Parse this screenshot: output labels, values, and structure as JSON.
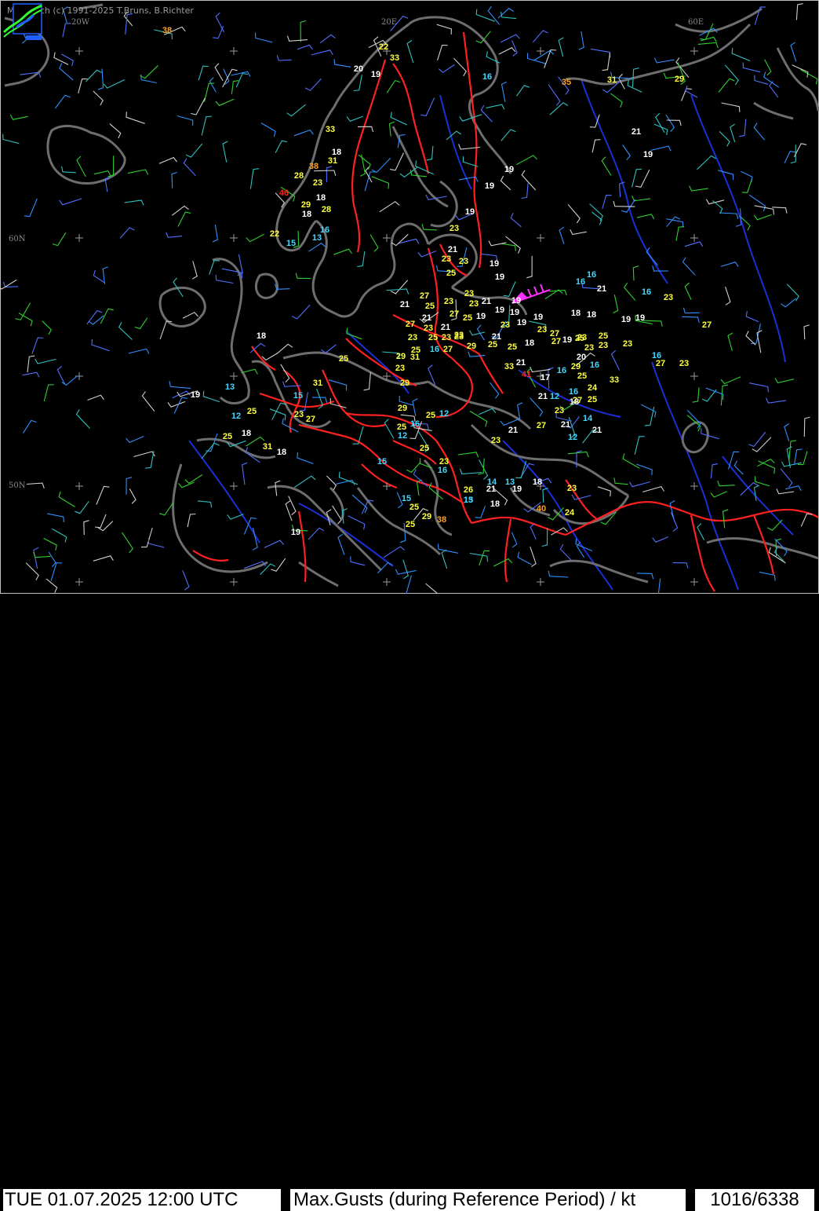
{
  "credit": "MetWatch  (c) 1991-2025 T.Bruns, B.Richter",
  "grid_labels": {
    "w20": "20W",
    "e20": "20E",
    "e60": "60E",
    "n60": "60N",
    "n50": "50N"
  },
  "status": {
    "datetime": "TUE 01.07.2025 12:00 UTC",
    "parameter": "Max.Gusts (during Reference Period) / kt",
    "counter": "1016/6338"
  },
  "colors": {
    "background": "#000000",
    "coast": "#6e6e6e",
    "border": "#ff2020",
    "river": "#1a2fd6",
    "gust_white": "#ffffff",
    "gust_cyan": "#40d8ff",
    "gust_yellow": "#ffff40",
    "gust_orange": "#ffa020",
    "gust_red": "#ff2020"
  },
  "gusts": [
    {
      "v": "38",
      "c": "o"
    },
    {
      "v": "22",
      "c": "y"
    },
    {
      "v": "33",
      "c": "y"
    },
    {
      "v": "20",
      "c": "w"
    },
    {
      "v": "19",
      "c": "w"
    },
    {
      "v": "16",
      "c": "c"
    },
    {
      "v": "35",
      "c": "o"
    },
    {
      "v": "31",
      "c": "y"
    },
    {
      "v": "29",
      "c": "y"
    },
    {
      "v": "33",
      "c": "y"
    },
    {
      "v": "21",
      "c": "w"
    },
    {
      "v": "18",
      "c": "w"
    },
    {
      "v": "31",
      "c": "y"
    },
    {
      "v": "19",
      "c": "w"
    },
    {
      "v": "38",
      "c": "o"
    },
    {
      "v": "28",
      "c": "y"
    },
    {
      "v": "23",
      "c": "y"
    },
    {
      "v": "19",
      "c": "w"
    },
    {
      "v": "46",
      "c": "r"
    },
    {
      "v": "18",
      "c": "w"
    },
    {
      "v": "19",
      "c": "w"
    },
    {
      "v": "29",
      "c": "y"
    },
    {
      "v": "28",
      "c": "y"
    },
    {
      "v": "18",
      "c": "w"
    },
    {
      "v": "19",
      "c": "w"
    },
    {
      "v": "23",
      "c": "y"
    },
    {
      "v": "16",
      "c": "c"
    },
    {
      "v": "22",
      "c": "y"
    },
    {
      "v": "13",
      "c": "c"
    },
    {
      "v": "15",
      "c": "c"
    },
    {
      "v": "21",
      "c": "w"
    },
    {
      "v": "23",
      "c": "y"
    },
    {
      "v": "23",
      "c": "y"
    },
    {
      "v": "19",
      "c": "w"
    },
    {
      "v": "25",
      "c": "y"
    },
    {
      "v": "19",
      "c": "w"
    },
    {
      "v": "16",
      "c": "c"
    },
    {
      "v": "16",
      "c": "c"
    },
    {
      "v": "21",
      "c": "w"
    },
    {
      "v": "23",
      "c": "y"
    },
    {
      "v": "16",
      "c": "c"
    },
    {
      "v": "27",
      "c": "y"
    },
    {
      "v": "21",
      "c": "w"
    },
    {
      "v": "25",
      "c": "y"
    },
    {
      "v": "23",
      "c": "y"
    },
    {
      "v": "23",
      "c": "y"
    },
    {
      "v": "21",
      "c": "w"
    },
    {
      "v": "19",
      "c": "m"
    },
    {
      "v": "19",
      "c": "w"
    },
    {
      "v": "23",
      "c": "y"
    },
    {
      "v": "21",
      "c": "w"
    },
    {
      "v": "27",
      "c": "y"
    },
    {
      "v": "25",
      "c": "y"
    },
    {
      "v": "19",
      "c": "w"
    },
    {
      "v": "19",
      "c": "w"
    },
    {
      "v": "18",
      "c": "w"
    },
    {
      "v": "18",
      "c": "w"
    },
    {
      "v": "19",
      "c": "w"
    },
    {
      "v": "19",
      "c": "w"
    },
    {
      "v": "19",
      "c": "w"
    },
    {
      "v": "27",
      "c": "y"
    },
    {
      "v": "27",
      "c": "y"
    },
    {
      "v": "23",
      "c": "y"
    },
    {
      "v": "21",
      "c": "w"
    },
    {
      "v": "23",
      "c": "y"
    },
    {
      "v": "19",
      "c": "w"
    },
    {
      "v": "23",
      "c": "y"
    },
    {
      "v": "27",
      "c": "y"
    },
    {
      "v": "23",
      "c": "y"
    },
    {
      "v": "18",
      "c": "w"
    },
    {
      "v": "23",
      "c": "y"
    },
    {
      "v": "25",
      "c": "y"
    },
    {
      "v": "23",
      "c": "y"
    },
    {
      "v": "23",
      "c": "y"
    },
    {
      "v": "21",
      "c": "w"
    },
    {
      "v": "23",
      "c": "y"
    },
    {
      "v": "19",
      "c": "w"
    },
    {
      "v": "25",
      "c": "y"
    },
    {
      "v": "25",
      "c": "y"
    },
    {
      "v": "27",
      "c": "y"
    },
    {
      "v": "29",
      "c": "y"
    },
    {
      "v": "25",
      "c": "y"
    },
    {
      "v": "23",
      "c": "y"
    },
    {
      "v": "23",
      "c": "y"
    },
    {
      "v": "23",
      "c": "y"
    },
    {
      "v": "18",
      "c": "w"
    },
    {
      "v": "25",
      "c": "y"
    },
    {
      "v": "16",
      "c": "c"
    },
    {
      "v": "27",
      "c": "y"
    },
    {
      "v": "25",
      "c": "y"
    },
    {
      "v": "29",
      "c": "y"
    },
    {
      "v": "31",
      "c": "y"
    },
    {
      "v": "25",
      "c": "y"
    },
    {
      "v": "21",
      "c": "w"
    },
    {
      "v": "33",
      "c": "y"
    },
    {
      "v": "16",
      "c": "c"
    },
    {
      "v": "20",
      "c": "w"
    },
    {
      "v": "16",
      "c": "c"
    },
    {
      "v": "27",
      "c": "y"
    },
    {
      "v": "23",
      "c": "y"
    },
    {
      "v": "23",
      "c": "y"
    },
    {
      "v": "31",
      "c": "y"
    },
    {
      "v": "29",
      "c": "y"
    },
    {
      "v": "41",
      "c": "r"
    },
    {
      "v": "17",
      "c": "w"
    },
    {
      "v": "16",
      "c": "c"
    },
    {
      "v": "29",
      "c": "y"
    },
    {
      "v": "25",
      "c": "y"
    },
    {
      "v": "33",
      "c": "y"
    },
    {
      "v": "19",
      "c": "w"
    },
    {
      "v": "13",
      "c": "c"
    },
    {
      "v": "15",
      "c": "c"
    },
    {
      "v": "24",
      "c": "y"
    },
    {
      "v": "16",
      "c": "c"
    },
    {
      "v": "12",
      "c": "c"
    },
    {
      "v": "25",
      "c": "y"
    },
    {
      "v": "23",
      "c": "y"
    },
    {
      "v": "27",
      "c": "y"
    },
    {
      "v": "29",
      "c": "y"
    },
    {
      "v": "25",
      "c": "y"
    },
    {
      "v": "27",
      "c": "y"
    },
    {
      "v": "21",
      "c": "w"
    },
    {
      "v": "12",
      "c": "c"
    },
    {
      "v": "18",
      "c": "w"
    },
    {
      "v": "14",
      "c": "c"
    },
    {
      "v": "25",
      "c": "y"
    },
    {
      "v": "23",
      "c": "y"
    },
    {
      "v": "25",
      "c": "y"
    },
    {
      "v": "25",
      "c": "y"
    },
    {
      "v": "16",
      "c": "c"
    },
    {
      "v": "12",
      "c": "c"
    },
    {
      "v": "18",
      "c": "w"
    },
    {
      "v": "27",
      "c": "y"
    },
    {
      "v": "21",
      "c": "w"
    },
    {
      "v": "21",
      "c": "w"
    },
    {
      "v": "21",
      "c": "w"
    },
    {
      "v": "12",
      "c": "c"
    },
    {
      "v": "23",
      "c": "y"
    },
    {
      "v": "31",
      "c": "y"
    },
    {
      "v": "18",
      "c": "w"
    },
    {
      "v": "12",
      "c": "c"
    },
    {
      "v": "25",
      "c": "y"
    },
    {
      "v": "15",
      "c": "c"
    },
    {
      "v": "23",
      "c": "y"
    },
    {
      "v": "16",
      "c": "c"
    },
    {
      "v": "26",
      "c": "y"
    },
    {
      "v": "14",
      "c": "c"
    },
    {
      "v": "13",
      "c": "c"
    },
    {
      "v": "18",
      "c": "w"
    },
    {
      "v": "21",
      "c": "w"
    },
    {
      "v": "19",
      "c": "w"
    },
    {
      "v": "23",
      "c": "y"
    },
    {
      "v": "13",
      "c": "c"
    },
    {
      "v": "24",
      "c": "y"
    },
    {
      "v": "18",
      "c": "w"
    },
    {
      "v": "40",
      "c": "o"
    },
    {
      "v": "15",
      "c": "c"
    },
    {
      "v": "25",
      "c": "y"
    },
    {
      "v": "15",
      "c": "c"
    },
    {
      "v": "29",
      "c": "y"
    },
    {
      "v": "38",
      "c": "o"
    },
    {
      "v": "25",
      "c": "y"
    },
    {
      "v": "19",
      "c": "w"
    }
  ]
}
